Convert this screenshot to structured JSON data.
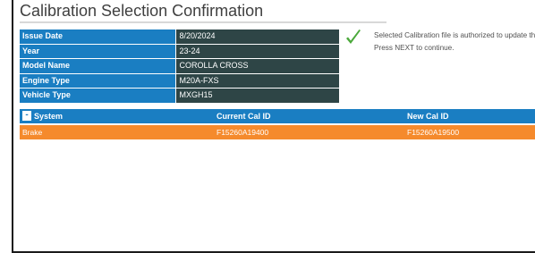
{
  "page": {
    "title": "Calibration Selection Confirmation"
  },
  "info": [
    {
      "label": "Issue Date",
      "value": "8/20/2024"
    },
    {
      "label": "Year",
      "value": "23-24"
    },
    {
      "label": "Model Name",
      "value": "COROLLA CROSS"
    },
    {
      "label": "Engine Type",
      "value": "M20A-FXS"
    },
    {
      "label": "Vehicle Type",
      "value": "MXGH15"
    }
  ],
  "message": {
    "line1": "Selected Calibration file is authorized to update this vehicle",
    "line2": "Press NEXT to continue.",
    "icon": "checkmark-icon",
    "icon_color": "#4aa83a"
  },
  "systems_table": {
    "collapse_symbol": "-",
    "headers": {
      "system": "System",
      "current": "Current Cal ID",
      "new": "New Cal ID"
    },
    "rows": [
      {
        "system": "Brake",
        "current": "F15260A19400",
        "new": "F15260A19500"
      }
    ]
  },
  "colors": {
    "label_bg": "#1a7ec2",
    "value_bg": "#2e4546",
    "header_bg": "#1a7ec2",
    "selected_row_bg": "#f58a2c"
  }
}
